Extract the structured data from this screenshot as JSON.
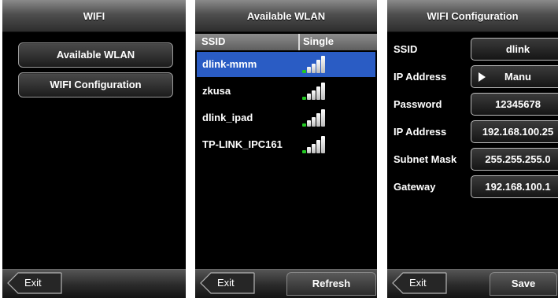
{
  "wifi_menu": {
    "title": "WIFI",
    "items": [
      "Available WLAN",
      "WIFI Configuration"
    ],
    "exit_label": "Exit"
  },
  "wlan_list": {
    "title": "Available WLAN",
    "col_ssid": "SSID",
    "col_signal": "Single",
    "networks": [
      {
        "ssid": "dlink-mmm",
        "selected": true
      },
      {
        "ssid": "zkusa",
        "selected": false
      },
      {
        "ssid": "dlink_ipad",
        "selected": false
      },
      {
        "ssid": "TP-LINK_IPC161",
        "selected": false
      }
    ],
    "exit_label": "Exit",
    "refresh_label": "Refresh"
  },
  "wifi_config": {
    "title": "WIFI Configuration",
    "fields": [
      {
        "label": "SSID",
        "value": "dlink"
      },
      {
        "label": "IP Address",
        "value": "Manu"
      },
      {
        "label": "Password",
        "value": "12345678"
      },
      {
        "label": "IP Address",
        "value": "192.168.100.25"
      },
      {
        "label": "Subnet Mask",
        "value": "255.255.255.0"
      },
      {
        "label": "Gateway",
        "value": "192.168.100.1"
      }
    ],
    "exit_label": "Exit",
    "save_label": "Save"
  },
  "colors": {
    "selection": "#2a5cc4",
    "signal_green": "#22c822"
  }
}
